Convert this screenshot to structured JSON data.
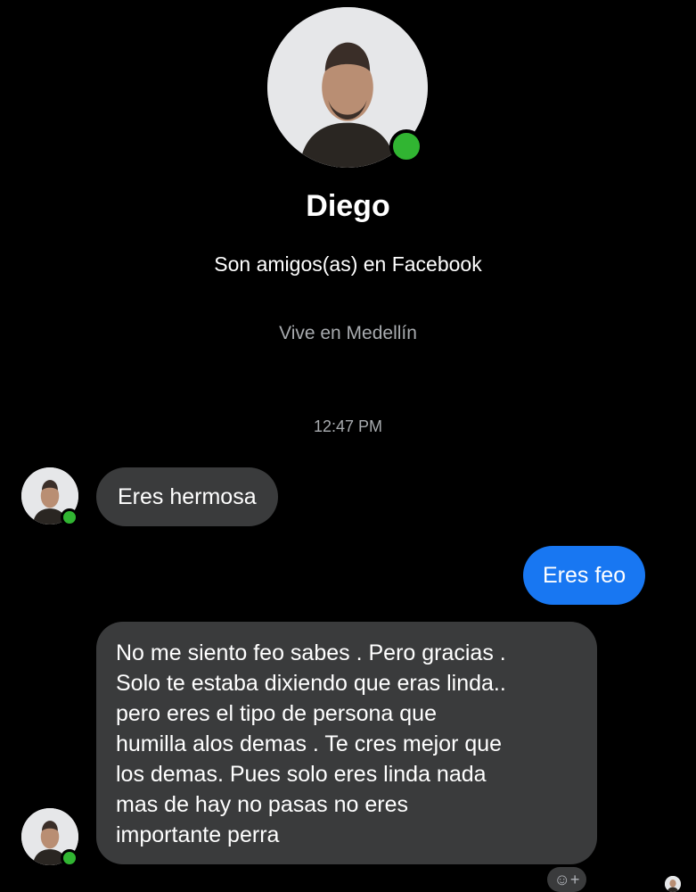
{
  "profile": {
    "name": "Diego",
    "friends_text": "Son amigos(as) en Facebook",
    "location_text": "Vive en Medellín",
    "avatar_icon": "person-avatar-icon",
    "online": true
  },
  "conversation": {
    "timestamp": "12:47 PM",
    "messages": [
      {
        "sender": "Diego",
        "direction": "incoming",
        "text": "Eres hermosa"
      },
      {
        "sender": "me",
        "direction": "outgoing",
        "text": "Eres feo"
      },
      {
        "sender": "Diego",
        "direction": "incoming",
        "text": "No me siento feo sabes . Pero gracias .\nSolo te estaba dixiendo que eras linda..\npero eres el tipo de persona que\nhumilla alos demas . Te cres mejor que\nlos demas. Pues solo eres linda nada\nmas de hay no pasas no eres\nimportante perra"
      }
    ],
    "reaction_icon": "add-reaction-icon",
    "reaction_symbol": "☺+",
    "read_receipt_icon": "seen-avatar-icon"
  },
  "colors": {
    "background": "#000000",
    "incoming_bubble": "#3a3b3c",
    "outgoing_bubble": "#1877f2",
    "online_green": "#31b532",
    "muted_text": "#a8abaf"
  }
}
